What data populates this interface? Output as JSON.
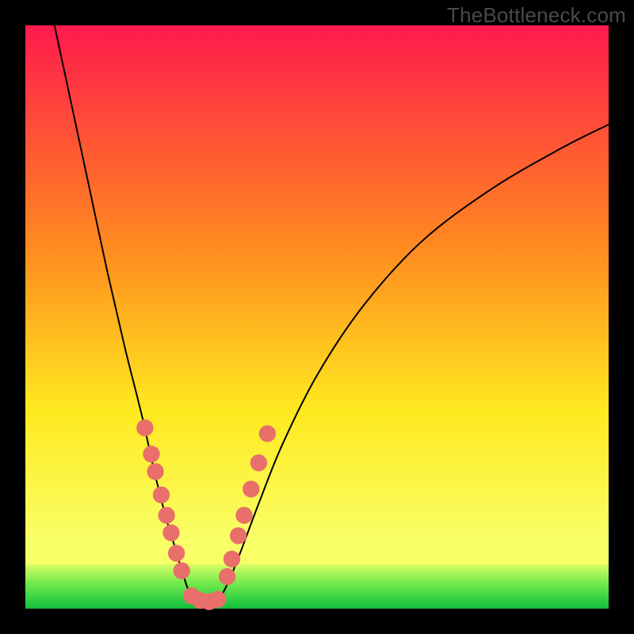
{
  "watermark": "TheBottleneck.com",
  "colors": {
    "frame": "#000000",
    "gradient_top": "#ff1a4d",
    "gradient_mid1": "#ff8a1f",
    "gradient_mid2": "#ffe91f",
    "gradient_low": "#f9ff66",
    "green_top": "#d9ff66",
    "green_mid": "#6fe84b",
    "green_bottom": "#0fbf3c",
    "curve": "#000000",
    "dot": "#e96f6a"
  },
  "layout": {
    "plot_inset": 32,
    "plot_size": 736,
    "green_band_top": 680,
    "green_band_height": 56
  },
  "chart_data": {
    "type": "line",
    "title": "",
    "xlabel": "",
    "ylabel": "",
    "xlim": [
      0,
      100
    ],
    "ylim": [
      0,
      100
    ],
    "grid": false,
    "series": [
      {
        "name": "left-curve",
        "x": [
          5,
          8,
          11,
          14,
          17,
          20,
          22,
          24,
          25.5,
          27,
          28,
          29
        ],
        "y": [
          100,
          86,
          72,
          58,
          45,
          33,
          24,
          16,
          11,
          6,
          3,
          1
        ]
      },
      {
        "name": "right-curve",
        "x": [
          33,
          35,
          37,
          40,
          44,
          50,
          58,
          68,
          80,
          92,
          100
        ],
        "y": [
          1,
          5,
          10,
          18,
          28,
          40,
          52,
          63,
          72,
          79,
          83
        ]
      },
      {
        "name": "bottom-join",
        "x": [
          29,
          30,
          31,
          32,
          33
        ],
        "y": [
          1,
          0.4,
          0.2,
          0.4,
          1
        ]
      }
    ],
    "dots": {
      "left": [
        [
          20.5,
          31
        ],
        [
          21.6,
          26.5
        ],
        [
          22.3,
          23.5
        ],
        [
          23.3,
          19.5
        ],
        [
          24.2,
          16
        ],
        [
          25.0,
          13
        ],
        [
          25.9,
          9.5
        ],
        [
          26.8,
          6.5
        ]
      ],
      "right": [
        [
          34.6,
          5.5
        ],
        [
          35.4,
          8.5
        ],
        [
          36.5,
          12.5
        ],
        [
          37.5,
          16
        ],
        [
          38.7,
          20.5
        ],
        [
          40.0,
          25
        ],
        [
          41.5,
          30
        ]
      ],
      "bottom": [
        [
          28.5,
          2.2
        ],
        [
          30.0,
          1.4
        ],
        [
          31.5,
          1.2
        ],
        [
          33.0,
          1.6
        ]
      ],
      "radius_pct": 1.45
    }
  }
}
